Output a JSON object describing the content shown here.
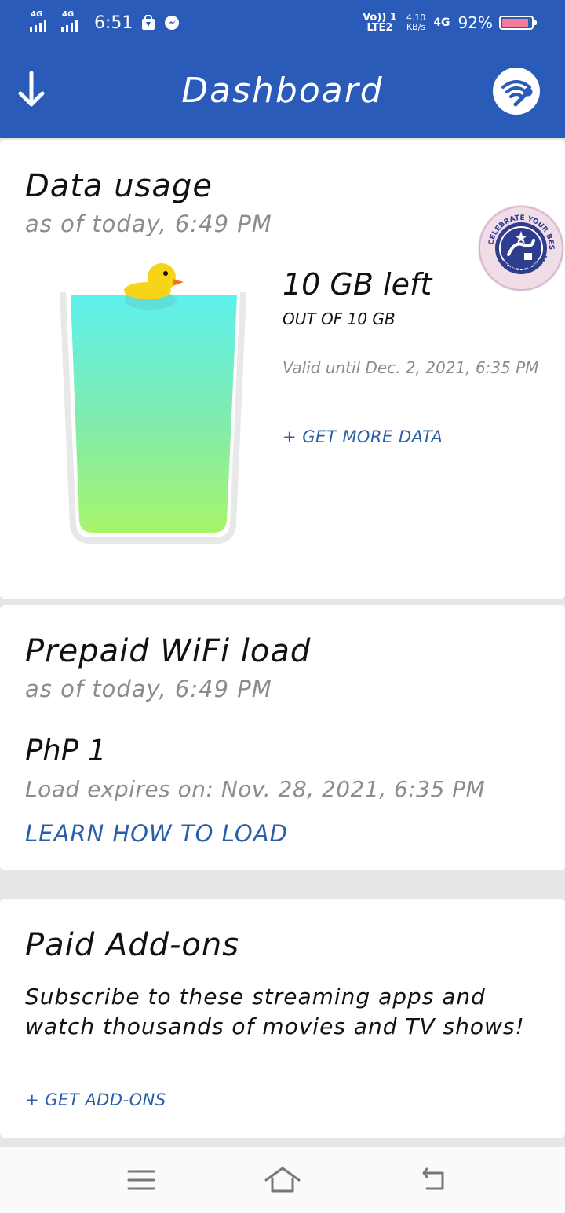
{
  "status_bar": {
    "sim1_tech": "4G",
    "sim2_tech": "4G",
    "time": "6:51",
    "volte_top": "Vo)) 1",
    "volte_bottom": "LTE2",
    "speed_value": "4.10",
    "speed_unit": "KB/s",
    "network": "4G",
    "battery_percent": "92%",
    "battery_level": 0.92,
    "icons": [
      "signal-icon",
      "signal-icon",
      "store-bag-icon",
      "messenger-icon",
      "battery-icon"
    ]
  },
  "app_bar": {
    "title": "Dashboard",
    "left_icon": "download-arrow-icon",
    "right_icon": "wifi-tools-icon",
    "background_color": "#2a5bb8"
  },
  "data_usage": {
    "title": "Data usage",
    "subtitle": "as of today, 6:49 PM",
    "left_amount": "10 GB left",
    "total": "OUT OF 10 GB",
    "valid_until": "Valid until Dec. 2, 2021, 6:35 PM",
    "get_more": "+ GET MORE DATA",
    "fill_level": 1.0,
    "badge_icon": "celebrate-your-best-christmas-badge",
    "badge_text_top": "CELEBRATE YOUR BEST",
    "badge_text_bottom": "THIS CHRISTMAS"
  },
  "prepaid": {
    "title": "Prepaid WiFi load",
    "subtitle": "as of today, 6:49 PM",
    "balance": "PhP 1",
    "expires": "Load expires on: Nov. 28, 2021, 6:35 PM",
    "learn_link": "LEARN HOW TO LOAD"
  },
  "addons": {
    "title": "Paid Add-ons",
    "description": "Subscribe to these streaming apps and watch thousands of movies and TV shows!",
    "link": "+ GET ADD-ONS"
  },
  "nav_bar": {
    "items": [
      "menu-icon",
      "home-icon",
      "back-icon"
    ]
  },
  "colors": {
    "brand_blue": "#2a5bb8",
    "link_blue": "#2a5ea8",
    "muted_gray": "#8c8c8c"
  }
}
